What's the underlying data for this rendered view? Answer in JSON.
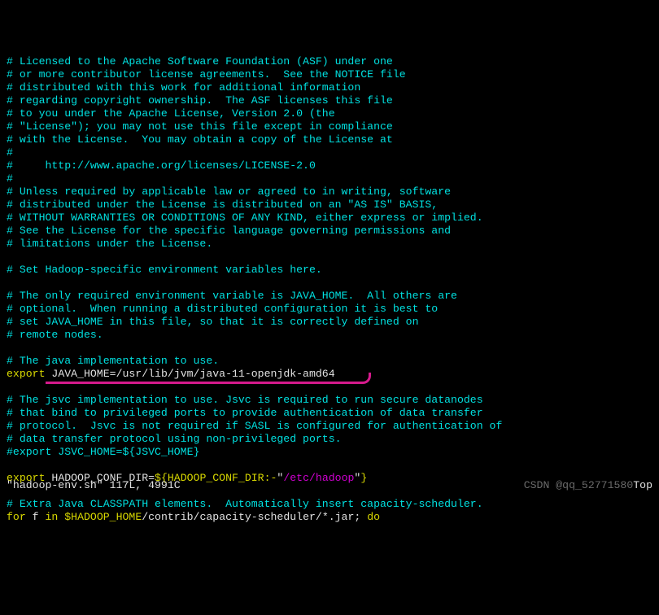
{
  "lines": {
    "c1": "# Licensed to the Apache Software Foundation (ASF) under one",
    "c2": "# or more contributor license agreements.  See the NOTICE file",
    "c3": "# distributed with this work for additional information",
    "c4": "# regarding copyright ownership.  The ASF licenses this file",
    "c5": "# to you under the Apache License, Version 2.0 (the",
    "c6": "# \"License\"); you may not use this file except in compliance",
    "c7": "# with the License.  You may obtain a copy of the License at",
    "c8": "#",
    "c9": "#     http://www.apache.org/licenses/LICENSE-2.0",
    "c10": "#",
    "c11": "# Unless required by applicable law or agreed to in writing, software",
    "c12": "# distributed under the License is distributed on an \"AS IS\" BASIS,",
    "c13": "# WITHOUT WARRANTIES OR CONDITIONS OF ANY KIND, either express or implied.",
    "c14": "# See the License for the specific language governing permissions and",
    "c15": "# limitations under the License.",
    "c16": "# Set Hadoop-specific environment variables here.",
    "c17": "# The only required environment variable is JAVA_HOME.  All others are",
    "c18": "# optional.  When running a distributed configuration it is best to",
    "c19": "# set JAVA_HOME in this file, so that it is correctly defined on",
    "c20": "# remote nodes.",
    "c21": "# The java implementation to use.",
    "c22": "# The jsvc implementation to use. Jsvc is required to run secure datanodes",
    "c23": "# that bind to privileged ports to provide authentication of data transfer",
    "c24": "# protocol.  Jsvc is not required if SASL is configured for authentication of",
    "c25": "# data transfer protocol using non-privileged ports.",
    "c26": "#export JSVC_HOME=${JSVC_HOME}",
    "c27": "# Extra Java CLASSPATH elements.  Automatically insert capacity-scheduler."
  },
  "export1": {
    "kw": "export",
    "var": "JAVA_HOME",
    "eq": "=",
    "val": "/usr/lib/jvm/java-11-openjdk-amd64"
  },
  "export2": {
    "kw": "export",
    "var": "HADOOP_CONF_DIR",
    "eq": "=",
    "interp": "${HADOOP_CONF_DIR:-",
    "quote": "\"",
    "str": "/etc/hadoop",
    "closeinterp": "}"
  },
  "forloop": {
    "kw1": "for",
    "var": "f",
    "kw2": "in",
    "interp": "$HADOOP_HOME",
    "rest": "/contrib/capacity-scheduler/*.jar;",
    "kw3": "do"
  },
  "status": {
    "left": "\"hadoop-env.sh\" 117L, 4991C",
    "watermark": "CSDN @qq_52771580",
    "right": "Top"
  }
}
